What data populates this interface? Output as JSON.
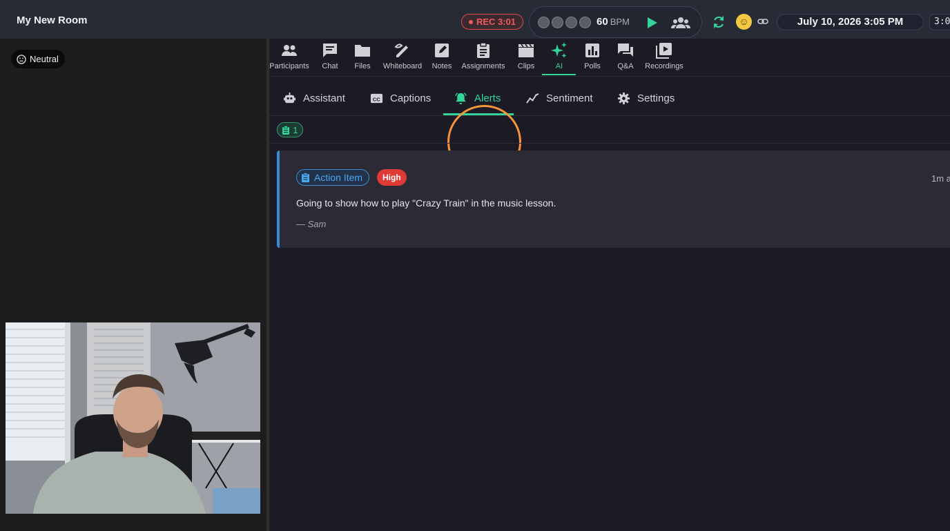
{
  "header": {
    "room_title": "My New Room",
    "recording": "REC 3:01",
    "metronome": {
      "bpm": "60",
      "bpm_unit": "BPM",
      "beats": 4
    },
    "datetime": "July 10, 2026 3:05 PM",
    "clock": "3:0"
  },
  "left_panel": {
    "mood_label": "Neutral"
  },
  "toolbar": {
    "items": [
      {
        "label": "Participants",
        "icon": "participants-icon"
      },
      {
        "label": "Chat",
        "icon": "chat-icon"
      },
      {
        "label": "Files",
        "icon": "folder-icon"
      },
      {
        "label": "Whiteboard",
        "icon": "whiteboard-icon"
      },
      {
        "label": "Notes",
        "icon": "notes-icon"
      },
      {
        "label": "Assignments",
        "icon": "clipboard-icon"
      },
      {
        "label": "Clips",
        "icon": "clapper-icon"
      },
      {
        "label": "AI",
        "icon": "sparkle-icon"
      },
      {
        "label": "Polls",
        "icon": "poll-icon"
      },
      {
        "label": "Q&A",
        "icon": "qa-icon"
      },
      {
        "label": "Recordings",
        "icon": "recordings-icon"
      }
    ],
    "active": "AI"
  },
  "ai_tabs": {
    "items": [
      {
        "label": "Assistant",
        "icon": "robot-icon"
      },
      {
        "label": "Captions",
        "icon": "captions-icon"
      },
      {
        "label": "Alerts",
        "icon": "bell-icon"
      },
      {
        "label": "Sentiment",
        "icon": "trend-icon"
      },
      {
        "label": "Settings",
        "icon": "gear-icon"
      }
    ],
    "active": "Alerts"
  },
  "filters": {
    "action_item_count": "1"
  },
  "alerts": [
    {
      "type": "Action Item",
      "priority": "High",
      "time": "1m a",
      "text": "Going to show how to play \"Crazy Train\" in the music lesson.",
      "author": "— Sam"
    }
  ],
  "colors": {
    "accent": "#34d39a",
    "record": "#ef5a5c",
    "action_item": "#4aa7f0",
    "priority_high": "#df3a35",
    "highlight_ring": "#f5943a"
  }
}
